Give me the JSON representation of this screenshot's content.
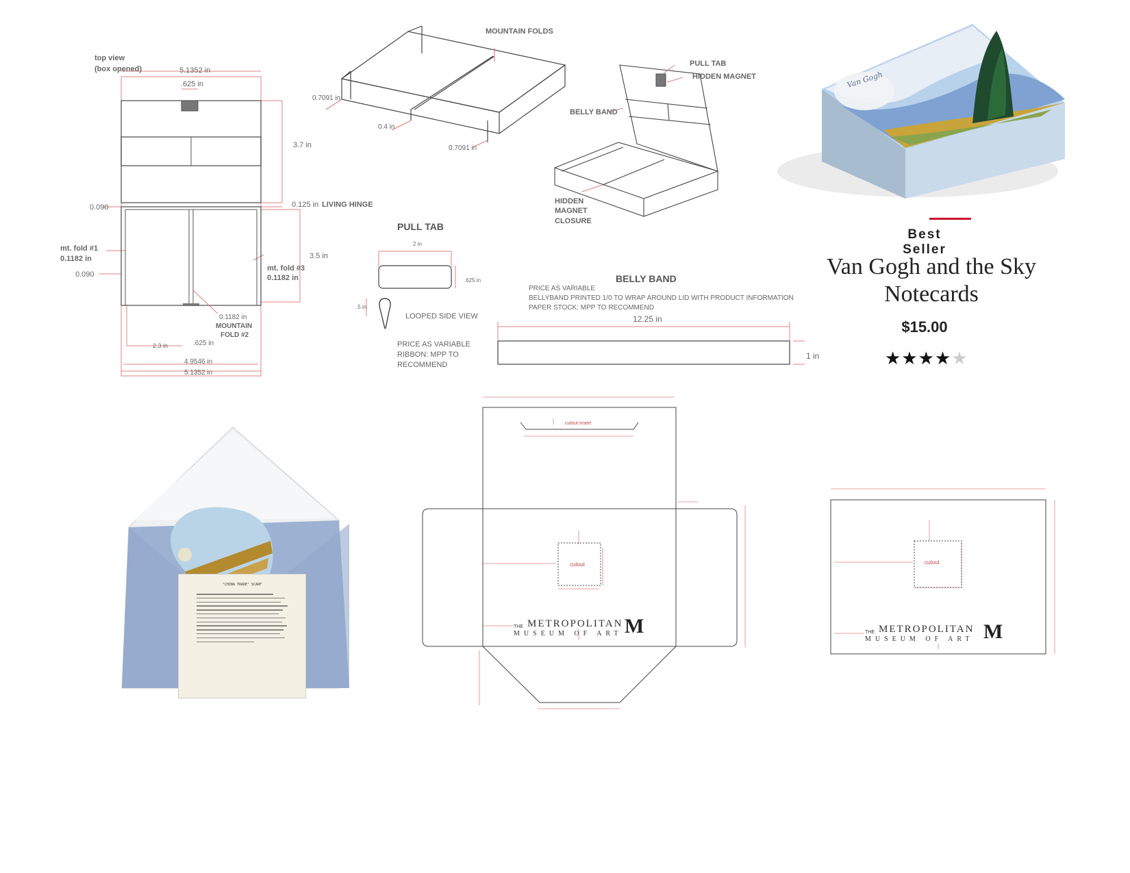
{
  "top_view": {
    "title_line1": "top view",
    "title_line2": "(box opened)",
    "dim_width_top": "5.1352 in",
    "dim_tab": ".625 in",
    "dim_height_lid": "3.7 in",
    "dim_090_a": "0.090",
    "dim_hinge_value": "0.125 in",
    "dim_hinge_label": "LIVING HINGE",
    "mt_fold_1_label": "mt. fold #1",
    "mt_fold_1_value": "0.1182 in",
    "dim_090_b": "0.090",
    "dim_height_base": "3.5 in",
    "mt_fold_3_label": "mt. fold #3",
    "mt_fold_3_value": "0.1182 in",
    "mt_fold_2_value": "0.1182 in",
    "mt_fold_2_label_1": "MOUNTAIN",
    "mt_fold_2_label_2": "FOLD #2",
    "dim_2_3": "2.3 in",
    "dim_625_bottom": ".625 in",
    "dim_4_9546": "4.9546 in",
    "dim_width_bottom": "5.1352 in"
  },
  "mountain_folds": {
    "title": "MOUNTAIN FOLDS",
    "dim_left": "0.7091 in",
    "dim_mid": "0.4 in",
    "dim_right": "0.7091 in"
  },
  "box_iso": {
    "pull_tab": "PULL TAB",
    "hidden_magnet": "HIDDEN MAGNET",
    "belly_band": "BELLY BAND",
    "closure_1": "HIDDEN",
    "closure_2": "MAGNET",
    "closure_3": "CLOSURE"
  },
  "pull_tab": {
    "title": "PULL TAB",
    "dim_width": "2 in",
    "dim_height": ".625 in",
    "dim_loop": ".5 in",
    "looped_label": "LOOPED SIDE VIEW",
    "note_1": "PRICE AS VARIABLE",
    "note_2": "RIBBON:  MPP TO",
    "note_3": "RECOMMEND"
  },
  "belly_band": {
    "title": "BELLY BAND",
    "note_1": "PRICE AS VARIABLE",
    "note_2": "BELLYBAND PRINTED 1/0 TO WRAP AROUND LID WITH PRODUCT INFORMATION",
    "note_3": "PAPER STOCK:  MPP TO RECOMMEND",
    "dim_width": "12.25 in",
    "dim_height": "1 in"
  },
  "product": {
    "badge": "Best Seller",
    "title": "Van Gogh and the Sky Notecards",
    "price": "$15.00",
    "rating": 4.5,
    "stars_full": "★★★★",
    "stars_half": "★",
    "box_lid_brand": "Van Gogh"
  },
  "letter": {
    "title": "\"CHINA TRADE\" SCARF"
  },
  "dieline_sleeve": {
    "cutout_insert": "cutout insert",
    "cutout": "cutout",
    "met_line_1_prefix": "THE",
    "met_line_1": "METROPOLITAN",
    "met_line_2": "MUSEUM OF ART",
    "met_mark": "M"
  },
  "dieline_card": {
    "cutout": "cutout",
    "met_line_1_prefix": "THE",
    "met_line_1": "METROPOLITAN",
    "met_line_2": "MUSEUM OF ART",
    "met_mark": "M"
  },
  "colors": {
    "dim_red": "#e08080",
    "line_gray": "#555555",
    "accent_red": "#c8102e",
    "envelope_blue": "#9db2d2"
  }
}
